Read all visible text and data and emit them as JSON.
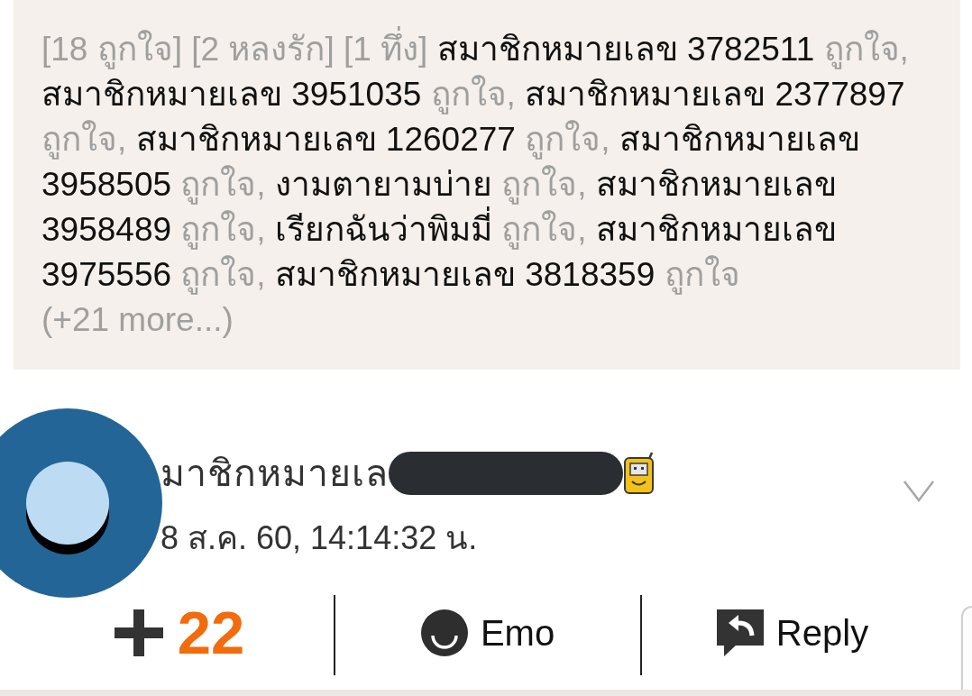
{
  "reactions": {
    "summary": [
      "[18 ถูกใจ]",
      "[2 หลงรัก]",
      "[1 ทึ่ง]"
    ],
    "likers": [
      {
        "name": "สมาชิกหมายเลข 3782511",
        "reaction": "ถูกใจ,"
      },
      {
        "name": "สมาชิกหมายเลข 3951035",
        "reaction": "ถูกใจ,"
      },
      {
        "name": "สมาชิกหมายเลข 2377897",
        "reaction": "ถูกใจ,"
      },
      {
        "name": "สมาชิกหมายเลข 1260277",
        "reaction": "ถูกใจ,"
      },
      {
        "name": "สมาชิกหมายเลข 3958505",
        "reaction": "ถูกใจ,"
      },
      {
        "name": "งามตายามบ่าย",
        "reaction": "ถูกใจ,"
      },
      {
        "name": "สมาชิกหมายเลข 3958489",
        "reaction": "ถูกใจ,"
      },
      {
        "name": "เรียกฉันว่าพิมมี่",
        "reaction": "ถูกใจ,"
      },
      {
        "name": "สมาชิกหมายเลข 3975556",
        "reaction": "ถูกใจ,"
      },
      {
        "name": "สมาชิกหมายเลข 3818359",
        "reaction": "ถูกใจ"
      }
    ],
    "more": "(+21 more...)"
  },
  "comment": {
    "author": "มาชิกหมายเล",
    "name_redacted": true,
    "timestamp": "8 ส.ค. 60, 14:14:32 น."
  },
  "actions": {
    "score": "22",
    "buttons": [
      {
        "kind": "emo",
        "label": "Emo"
      },
      {
        "kind": "reply",
        "label": "Reply"
      }
    ]
  }
}
